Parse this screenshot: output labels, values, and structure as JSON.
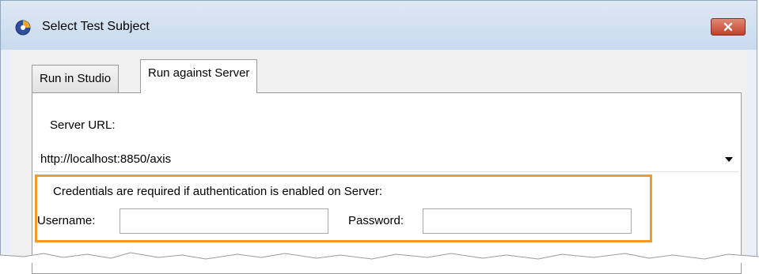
{
  "window": {
    "title": "Select Test Subject",
    "icon": "app-logo-icon",
    "close_icon": "close-icon"
  },
  "tabs": [
    {
      "label": "Run in Studio",
      "active": false
    },
    {
      "label": "Run against Server",
      "active": true
    }
  ],
  "server": {
    "url_label": "Server URL:",
    "url_value": "http://localhost:8850/axis"
  },
  "credentials": {
    "note": "Credentials are required if authentication is enabled on Server:",
    "username_label": "Username:",
    "username_value": "",
    "password_label": "Password:",
    "password_value": "",
    "highlight_color": "#f29b2a"
  }
}
